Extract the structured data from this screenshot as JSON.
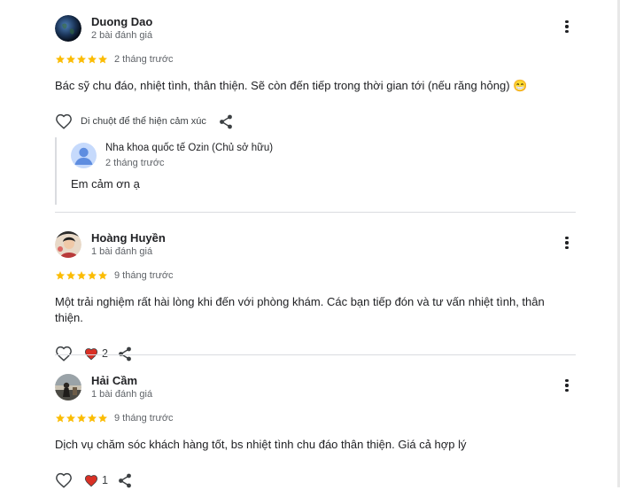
{
  "reviews": [
    {
      "name": "Duong Dao",
      "count": "2 bài đánh giá",
      "time": "2 tháng trước",
      "stars": 5,
      "text": "Bác sỹ chu đáo, nhiệt tình, thân thiện. Sẽ còn đến tiếp trong thời gian tới (nếu răng hỏng) 😁",
      "hint": "Di chuột để thể hiện cảm xúc",
      "owner_reply": {
        "name": "Nha khoa quốc tế Ozin (Chủ sở hữu)",
        "time": "2 tháng trước",
        "text": "Em cảm ơn ạ"
      }
    },
    {
      "name": "Hoàng Huyền",
      "count": "1 bài đánh giá",
      "time": "9 tháng trước",
      "stars": 5,
      "text": "Một trải nghiệm rất hài lòng khi đến với phòng khám. Các bạn tiếp đón và tư vấn nhiệt tình, thân thiện.",
      "likes": "2"
    },
    {
      "name": "Hải Cầm",
      "count": "1 bài đánh giá",
      "time": "9 tháng trước",
      "stars": 5,
      "text": "Dịch vụ chăm sóc khách hàng tốt, bs nhiệt tình chu đáo thân thiện. Giá cả hợp lý",
      "likes": "1"
    }
  ],
  "colors": {
    "star": "#fbbc04",
    "heart_filled": "#d93025",
    "divider": "#dadce0",
    "secondary_text": "#5f6368"
  },
  "icons": {
    "more": "more-vert-icon",
    "like": "heart-outline-icon",
    "liked": "heart-filled-icon",
    "share": "share-icon"
  }
}
